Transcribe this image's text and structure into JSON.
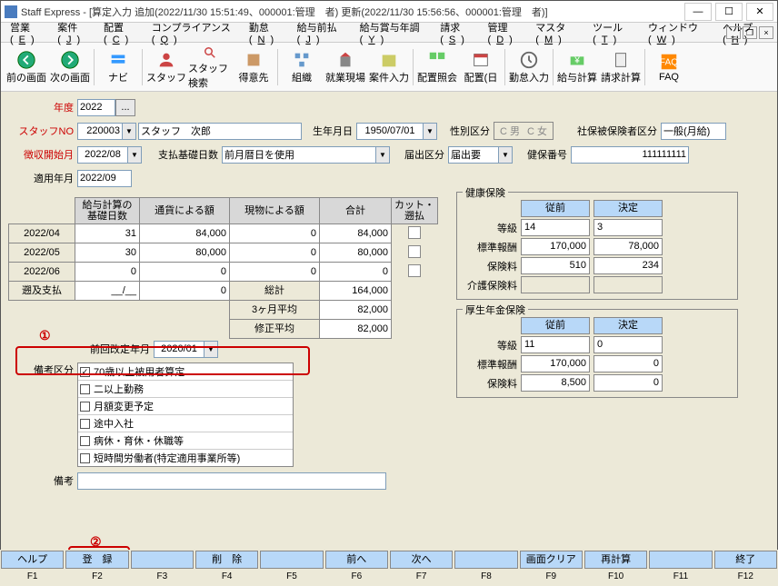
{
  "title": "Staff Express - [算定入力 追加(2022/11/30 15:51:49、000001:管理　者) 更新(2022/11/30 15:56:56、000001:管理　者)]",
  "menu": [
    "営業(E)",
    "案件(J)",
    "配置(C)",
    "コンプライアンス(Q)",
    "勤怠(N)",
    "給与前払(J)",
    "給与賞与年調(Y)",
    "請求(S)",
    "管理(D)",
    "マスタ(M)",
    "ツール(T)",
    "ウィンドウ(W)",
    "ヘルプ(H)"
  ],
  "tools": [
    {
      "n": "前の画面",
      "svg": "back"
    },
    {
      "n": "次の画面",
      "svg": "fwd"
    },
    "|",
    {
      "n": "ナビ",
      "svg": "navi"
    },
    "|",
    {
      "n": "スタッフ",
      "svg": "staff"
    },
    {
      "n": "スタッフ検索",
      "svg": "ssearch"
    },
    {
      "n": "得意先",
      "svg": "cust"
    },
    "|",
    {
      "n": "組織",
      "svg": "org"
    },
    {
      "n": "就業現場",
      "svg": "site"
    },
    {
      "n": "案件入力",
      "svg": "case"
    },
    "|",
    {
      "n": "配置照会",
      "svg": "pq"
    },
    {
      "n": "配置(日",
      "svg": "pd"
    },
    "|",
    {
      "n": "勤怠入力",
      "svg": "att"
    },
    "|",
    {
      "n": "給与計算",
      "svg": "pay"
    },
    {
      "n": "請求計算",
      "svg": "bill"
    },
    "|",
    {
      "n": "FAQ",
      "svg": "faq"
    }
  ],
  "labels": {
    "year": "年度",
    "staffno": "スタッフNO",
    "birth": "生年月日",
    "sex": "性別区分",
    "male": "C 男",
    "female": "C 女",
    "shahoku": "社保被保険者区分",
    "choshu": "徴収開始月",
    "shiharai": "支払基礎日数",
    "todoke": "届出区分",
    "kenpo": "健保番号",
    "teki": "適用年月",
    "kyuyo_kiso": "給与計算の\n基礎日数",
    "tsuka": "通貨による額",
    "genbutsu": "現物による額",
    "gokei": "合計",
    "cut": "カット・遡払",
    "sokyushiharai": "遡及支払",
    "sokei": "総計",
    "avg3": "3ヶ月平均",
    "shusei": "修正平均",
    "zenkai": "前回改定年月",
    "bikokbn": "備考区分",
    "biko": "備考",
    "kenko": "健康保険",
    "kosei": "厚生年金保険",
    "juzen": "従前",
    "kettei": "決定",
    "tokyu": "等級",
    "hyojun": "標準報酬",
    "hokenryo": "保険料",
    "kaigo": "介護保険料"
  },
  "vals": {
    "year": "2022",
    "staffno": "220003",
    "staffname": "スタッフ　次郎",
    "birth": "1950/07/01",
    "shahoku": "一般(月給)",
    "choshu": "2022/08",
    "shiharai": "前月暦日を使用",
    "todoke": "届出要",
    "kenpo": "111111111",
    "teki": "2022/09",
    "rows": [
      {
        "ym": "2022/04",
        "d": "31",
        "a": "84,000",
        "b": "0",
        "t": "84,000"
      },
      {
        "ym": "2022/05",
        "d": "30",
        "a": "80,000",
        "b": "0",
        "t": "80,000"
      },
      {
        "ym": "2022/06",
        "d": "0",
        "a": "0",
        "b": "0",
        "t": "0"
      }
    ],
    "sokyud": "__/__",
    "sokyua": "0",
    "sokei": "164,000",
    "avg3": "82,000",
    "zenkai": "2020/01",
    "shusei": "82,000",
    "kenko": {
      "tj": "14",
      "kt": "3",
      "hj": "170,000",
      "hk": "78,000",
      "rj": "510",
      "rk": "234",
      "kj": "",
      "kk": ""
    },
    "kosei": {
      "tj": "11",
      "kt": "0",
      "hj": "170,000",
      "hk": "0",
      "rj": "8,500",
      "rk": "0"
    }
  },
  "remarks": [
    {
      "c": true,
      "t": "70歳以上被用者算定"
    },
    {
      "c": false,
      "t": "二以上勤務"
    },
    {
      "c": false,
      "t": "月額変更予定"
    },
    {
      "c": false,
      "t": "途中入社"
    },
    {
      "c": false,
      "t": "病休・育休・休職等"
    },
    {
      "c": false,
      "t": "短時間労働者(特定適用事業所等)"
    }
  ],
  "ann": {
    "c1": "①",
    "c2": "②"
  },
  "fn": [
    {
      "b": "ヘルプ",
      "f": "F1"
    },
    {
      "b": "登　録",
      "f": "F2"
    },
    {
      "b": "",
      "f": "F3"
    },
    {
      "b": "削　除",
      "f": "F4"
    },
    {
      "b": "",
      "f": "F5"
    },
    {
      "b": "前へ",
      "f": "F6"
    },
    {
      "b": "次へ",
      "f": "F7"
    },
    {
      "b": "",
      "f": "F8"
    },
    {
      "b": "画面クリア",
      "f": "F9"
    },
    {
      "b": "再計算",
      "f": "F10"
    },
    {
      "b": "",
      "f": "F11"
    },
    {
      "b": "終了",
      "f": "F12"
    }
  ]
}
